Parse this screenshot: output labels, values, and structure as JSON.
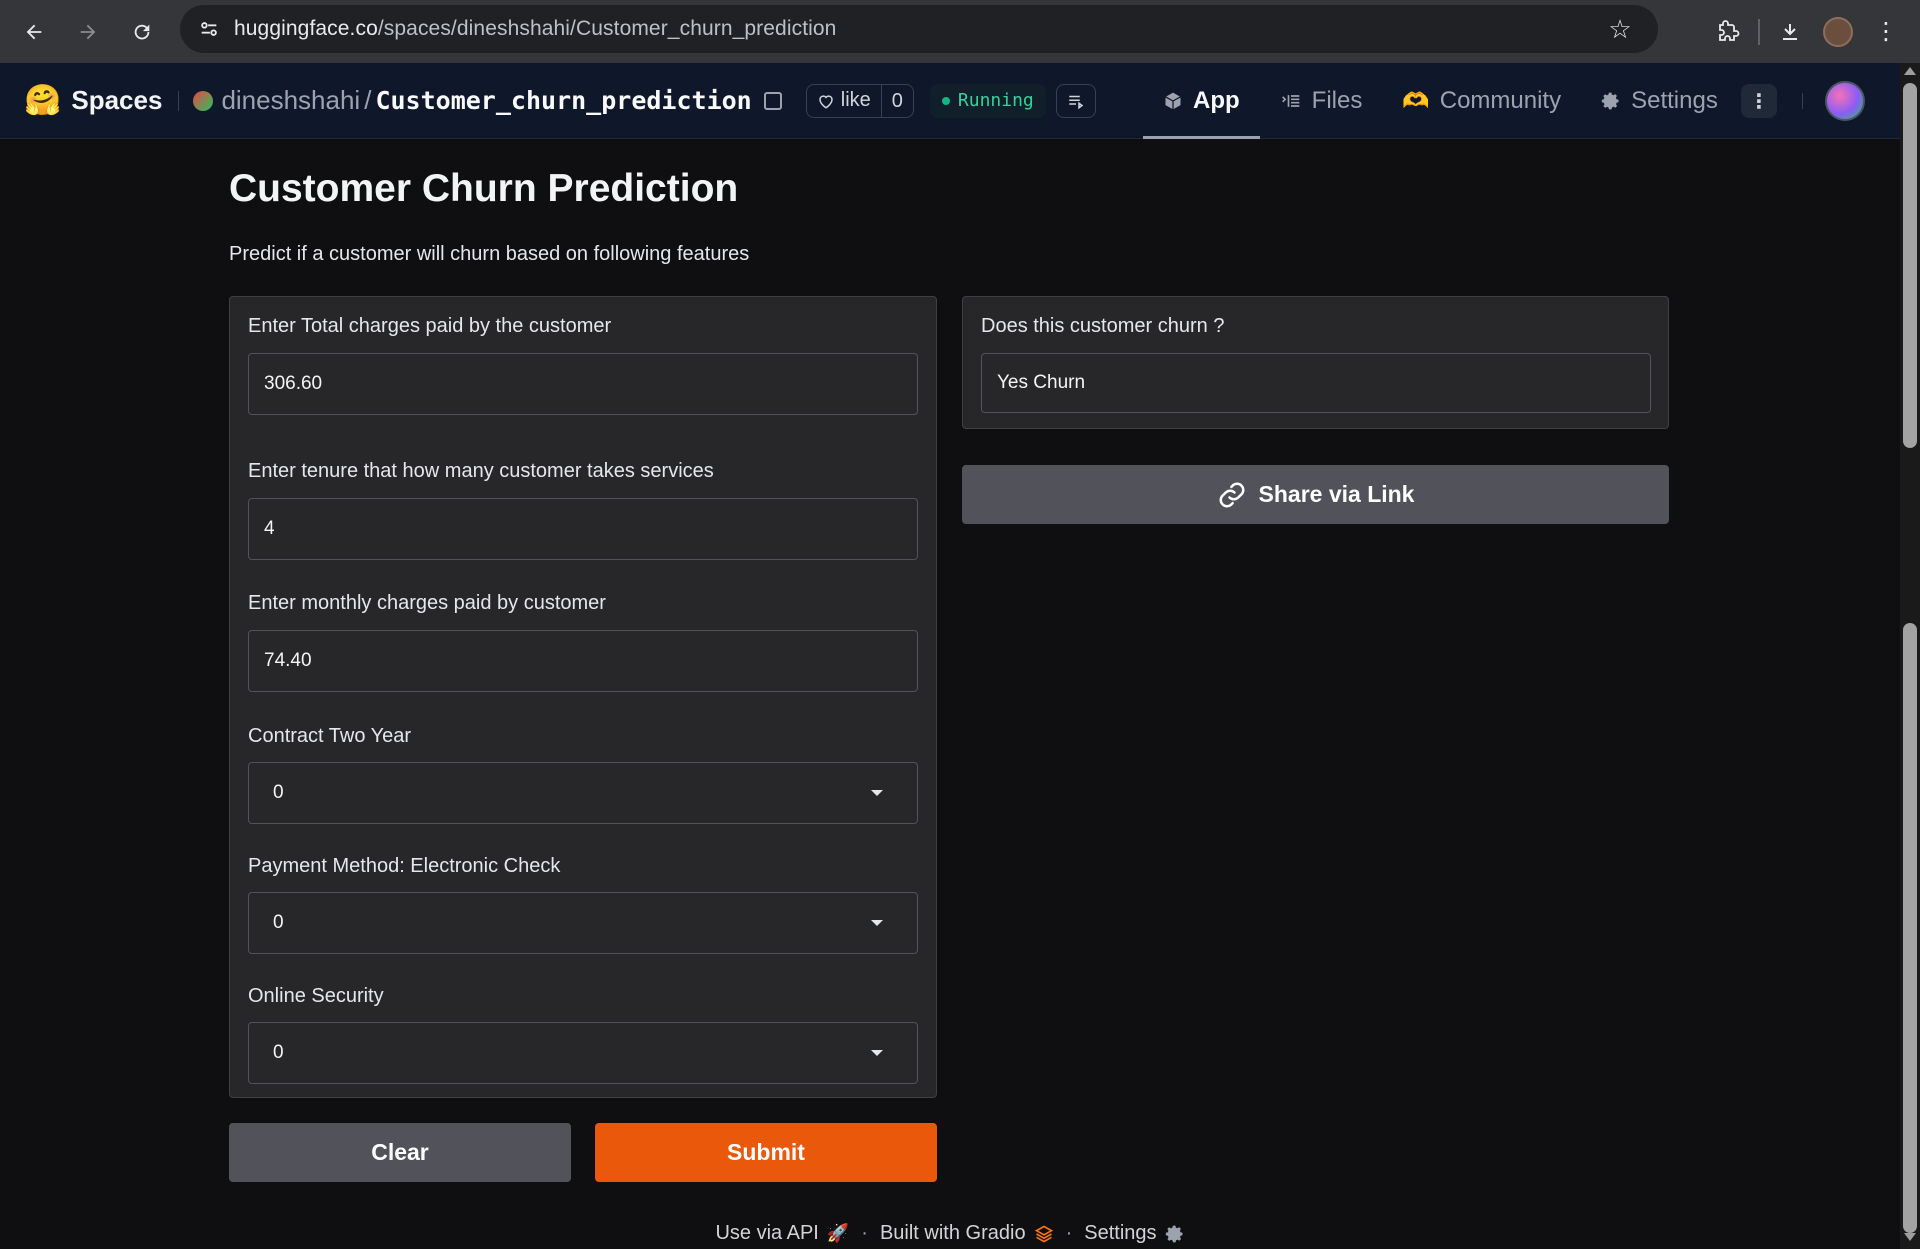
{
  "browser": {
    "url_host": "huggingface.co",
    "url_path": "/spaces/dineshshahi/Customer_churn_prediction"
  },
  "header": {
    "spaces_label": "Spaces",
    "owner": "dineshshahi",
    "separator": "/",
    "space_name": "Customer_churn_prediction",
    "like_label": "like",
    "like_count": "0",
    "status": "Running",
    "status_color": "#10b981",
    "tabs": [
      {
        "label": "App",
        "icon": "cube-icon",
        "active": true
      },
      {
        "label": "Files",
        "icon": "files-icon",
        "active": false
      },
      {
        "label": "Community",
        "icon": "community-icon",
        "active": false
      },
      {
        "label": "Settings",
        "icon": "gear-icon",
        "active": false
      }
    ]
  },
  "app": {
    "title": "Customer Churn Prediction",
    "description": "Predict if a customer will churn based on following features",
    "inputs": [
      {
        "label": "Enter Total charges paid by the customer",
        "value": "306.60",
        "type": "number"
      },
      {
        "label": "Enter tenure that how many customer takes services",
        "value": "4",
        "type": "number"
      },
      {
        "label": "Enter monthly charges paid by customer",
        "value": "74.40",
        "type": "number"
      },
      {
        "label": "Contract Two Year",
        "value": "0",
        "type": "dropdown"
      },
      {
        "label": "Payment Method: Electronic Check",
        "value": "0",
        "type": "dropdown"
      },
      {
        "label": "Online Security",
        "value": "0",
        "type": "dropdown"
      }
    ],
    "output": {
      "label": "Does this customer churn ?",
      "value": "Yes Churn"
    },
    "share_label": "Share via Link",
    "clear_label": "Clear",
    "submit_label": "Submit",
    "submit_color": "#ea580c"
  },
  "footer": {
    "api": "Use via API",
    "built": "Built with Gradio",
    "settings": "Settings",
    "separator": "·"
  }
}
